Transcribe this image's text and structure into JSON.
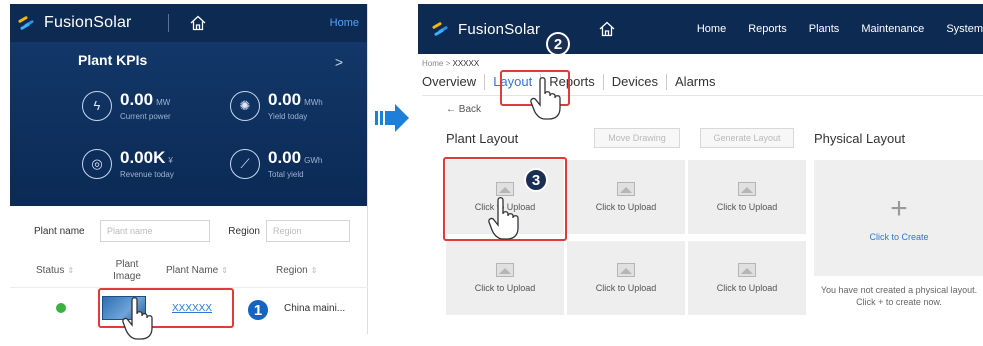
{
  "left": {
    "logo": "FusionSolar",
    "home_link": "Home",
    "kpi_title": "Plant KPIs",
    "kpi_more": ">",
    "kpis": [
      {
        "value": "0.00",
        "unit": "MW",
        "label": "Current power",
        "icon": "lightning-icon"
      },
      {
        "value": "0.00",
        "unit": "MWh",
        "label": "Yield today",
        "icon": "gear-sun-icon"
      },
      {
        "value": "0.00K",
        "unit": "¥",
        "label": "Revenue today",
        "icon": "coins-icon"
      },
      {
        "value": "0.00",
        "unit": "GWh",
        "label": "Total yield",
        "icon": "chart-icon"
      }
    ],
    "filter": {
      "plant_name_label": "Plant name",
      "plant_name_placeholder": "Plant name",
      "region_label": "Region",
      "region_placeholder": "Region"
    },
    "table": {
      "headers": [
        "Status",
        "Plant Image",
        "Plant Name",
        "Region"
      ],
      "sort": "⇕",
      "row": {
        "status_color": "#3cb043",
        "plant_name": "XXXXXX",
        "region": "China maini..."
      }
    },
    "step_badge": "1"
  },
  "right": {
    "logo": "FusionSolar",
    "nav": [
      "Home",
      "Reports",
      "Plants",
      "Maintenance",
      "System"
    ],
    "breadcrumb_home": "Home",
    "breadcrumb_sep": ">",
    "breadcrumb_current": "XXXXX",
    "tabs": [
      "Overview",
      "Layout",
      "Reports",
      "Devices",
      "Alarms"
    ],
    "back": "← Back",
    "plant_layout_title": "Plant Layout",
    "move_drawing": "Move Drawing",
    "generate_layout": "Generate Layout",
    "physical_layout_title": "Physical Layout",
    "upload_label": "Click to Upload",
    "create_plus": "+",
    "create_label": "Click to Create",
    "empty_message": "You have not created a physical layout. Click + to create now.",
    "step_badge_2": "2",
    "step_badge_3": "3"
  },
  "colors": {
    "header_bg": "#0d2a52",
    "accent": "#2a78d6",
    "highlight": "#e03a3a",
    "badge": "#1565c0"
  }
}
